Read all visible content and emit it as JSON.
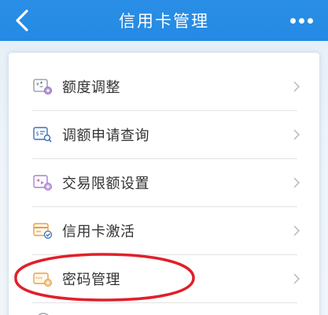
{
  "header": {
    "title": "信用卡管理",
    "background_color": "#248ae3"
  },
  "menu": {
    "items": [
      {
        "label": "额度调整",
        "icon": "credit-limit-adjust-icon"
      },
      {
        "label": "调额申请查询",
        "icon": "limit-query-icon"
      },
      {
        "label": "交易限额设置",
        "icon": "transaction-limit-icon"
      },
      {
        "label": "信用卡激活",
        "icon": "card-activate-icon"
      },
      {
        "label": "密码管理",
        "icon": "password-manage-icon"
      }
    ]
  },
  "colors": {
    "accent": "#248ae3",
    "annotation": "#e0202a",
    "icon_purple": "#9a7ac8",
    "icon_orange": "#e8a04a",
    "icon_blue": "#3d6fb8"
  }
}
